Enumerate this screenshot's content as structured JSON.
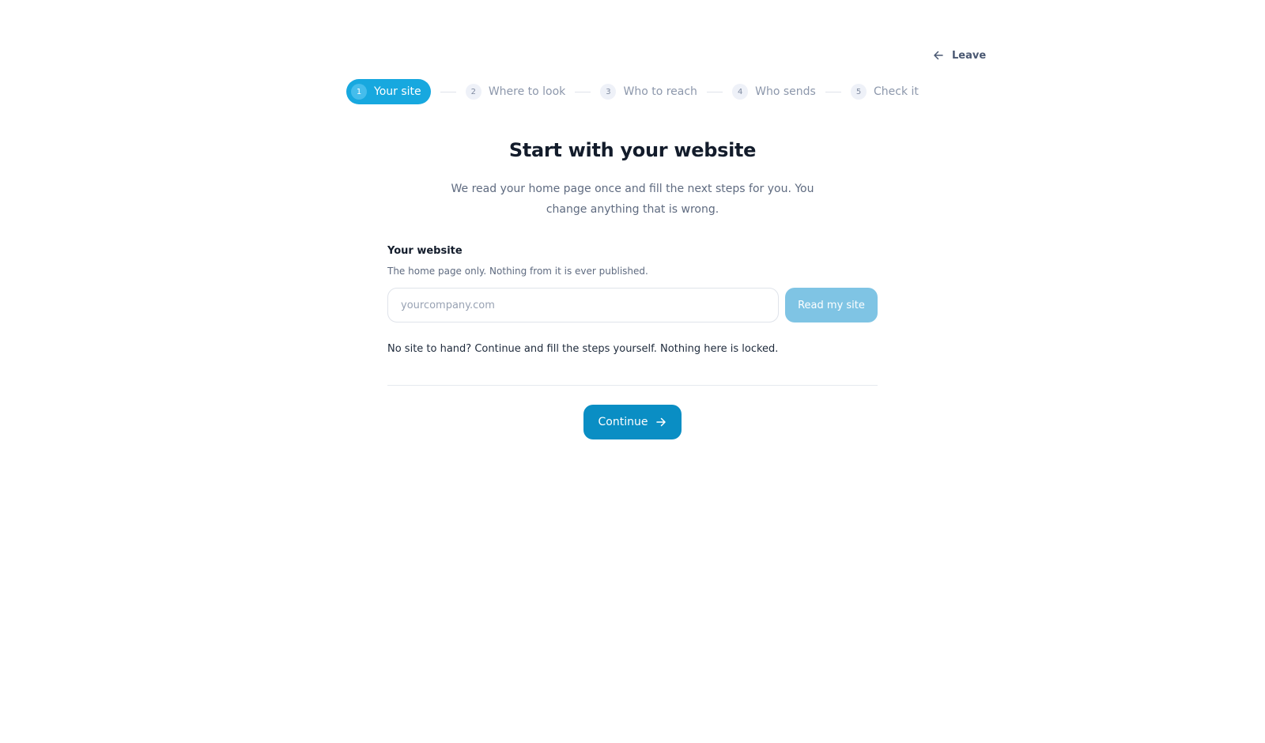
{
  "header": {
    "leave_label": "Leave",
    "leave_icon": "arrow-left-icon"
  },
  "stepper": {
    "steps": [
      {
        "number": "1",
        "label": "Your site",
        "active": true
      },
      {
        "number": "2",
        "label": "Where to look",
        "active": false
      },
      {
        "number": "3",
        "label": "Who to reach",
        "active": false
      },
      {
        "number": "4",
        "label": "Who sends",
        "active": false
      },
      {
        "number": "5",
        "label": "Check it",
        "active": false
      }
    ]
  },
  "main": {
    "title": "Start with your website",
    "subtitle": "We read your home page once and fill the next steps for you. You change anything that is wrong.",
    "website_field": {
      "label": "Your website",
      "help": "The home page only. Nothing from it is ever published.",
      "value": "",
      "placeholder": "yourcompany.com"
    },
    "read_button_label": "Read my site",
    "note": "No site to hand? Continue and fill the steps yourself. Nothing here is locked.",
    "continue_label": "Continue",
    "continue_icon": "arrow-right-icon"
  },
  "colors": {
    "accent": "#17a8df",
    "primary_button": "#0a8ec4",
    "disabled_button": "#7fc4e4",
    "title_text": "#131c2b",
    "muted_text": "#5f6b80"
  }
}
